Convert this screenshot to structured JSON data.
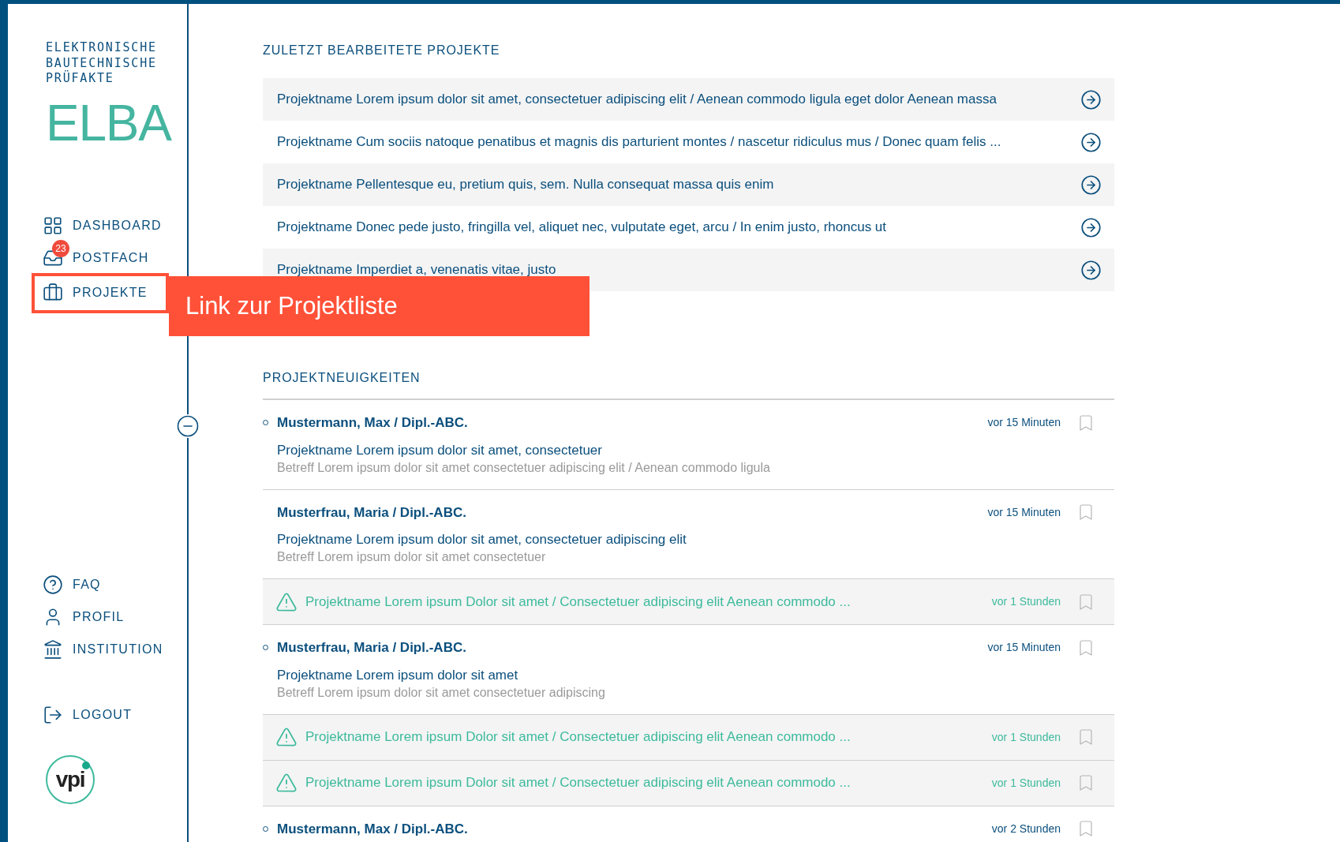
{
  "sidebar": {
    "subtitle_lines": [
      "ELEKTRONISCHE",
      "BAUTECHNISCHE",
      "PRÜFAKTE"
    ],
    "brand": "ELBA",
    "nav": [
      {
        "label": "DASHBOARD",
        "highlighted": false
      },
      {
        "label": "POSTFACH",
        "highlighted": false,
        "badge": "23"
      },
      {
        "label": "PROJEKTE",
        "highlighted": true
      }
    ],
    "bottom_nav": [
      {
        "label": "FAQ"
      },
      {
        "label": "PROFIL"
      },
      {
        "label": "INSTITUTION"
      }
    ],
    "logout": "LOGOUT",
    "logo": "vpi"
  },
  "callout": {
    "text": "Link zur Projektliste"
  },
  "recent_projects": {
    "title": "ZULETZT BEARBEITETE PROJEKTE",
    "items": [
      "Projektname Lorem ipsum dolor sit amet, consectetuer adipiscing elit / Aenean commodo ligula eget dolor Aenean massa",
      "Projektname Cum sociis natoque penatibus et magnis dis parturient montes / nascetur ridiculus mus / Donec quam felis ...",
      "Projektname Pellentesque eu, pretium quis, sem. Nulla consequat massa quis enim",
      "Projektname Donec pede justo, fringilla vel, aliquet nec, vulputate eget, arcu / In enim justo, rhoncus ut",
      "Projektname Imperdiet a, venenatis vitae, justo"
    ]
  },
  "news": {
    "title": "PROJEKTNEUIGKEITEN",
    "items": [
      {
        "kind": "message",
        "unread": true,
        "author": "Mustermann, Max / Dipl.-ABC.",
        "time": "vor 15 Minuten",
        "project": "Projektname Lorem ipsum dolor sit amet, consectetuer",
        "subject": "Betreff Lorem ipsum dolor sit amet consectetuer adipiscing elit / Aenean commodo ligula"
      },
      {
        "kind": "message",
        "unread": false,
        "author": "Musterfrau, Maria / Dipl.-ABC.",
        "time": "vor 15 Minuten",
        "project": "Projektname Lorem ipsum dolor sit amet, consectetuer adipiscing elit",
        "subject": "Betreff Lorem ipsum dolor sit amet consectetuer"
      },
      {
        "kind": "alert",
        "text": "Projektname Lorem ipsum Dolor sit amet / Consectetuer adipiscing elit Aenean commodo ...",
        "time": "vor 1 Stunden"
      },
      {
        "kind": "message",
        "unread": true,
        "author": "Musterfrau, Maria / Dipl.-ABC.",
        "time": "vor 15 Minuten",
        "project": "Projektname Lorem ipsum dolor sit amet",
        "subject": "Betreff Lorem ipsum dolor sit amet consectetuer adipiscing"
      },
      {
        "kind": "alert",
        "text": "Projektname Lorem ipsum Dolor sit amet / Consectetuer adipiscing elit Aenean commodo ...",
        "time": "vor 1 Stunden"
      },
      {
        "kind": "alert",
        "text": "Projektname Lorem ipsum Dolor sit amet / Consectetuer adipiscing elit Aenean commodo ...",
        "time": "vor 1 Stunden"
      },
      {
        "kind": "message",
        "unread": true,
        "author": "Mustermann, Max / Dipl.-ABC.",
        "time": "vor 2 Stunden"
      }
    ]
  }
}
